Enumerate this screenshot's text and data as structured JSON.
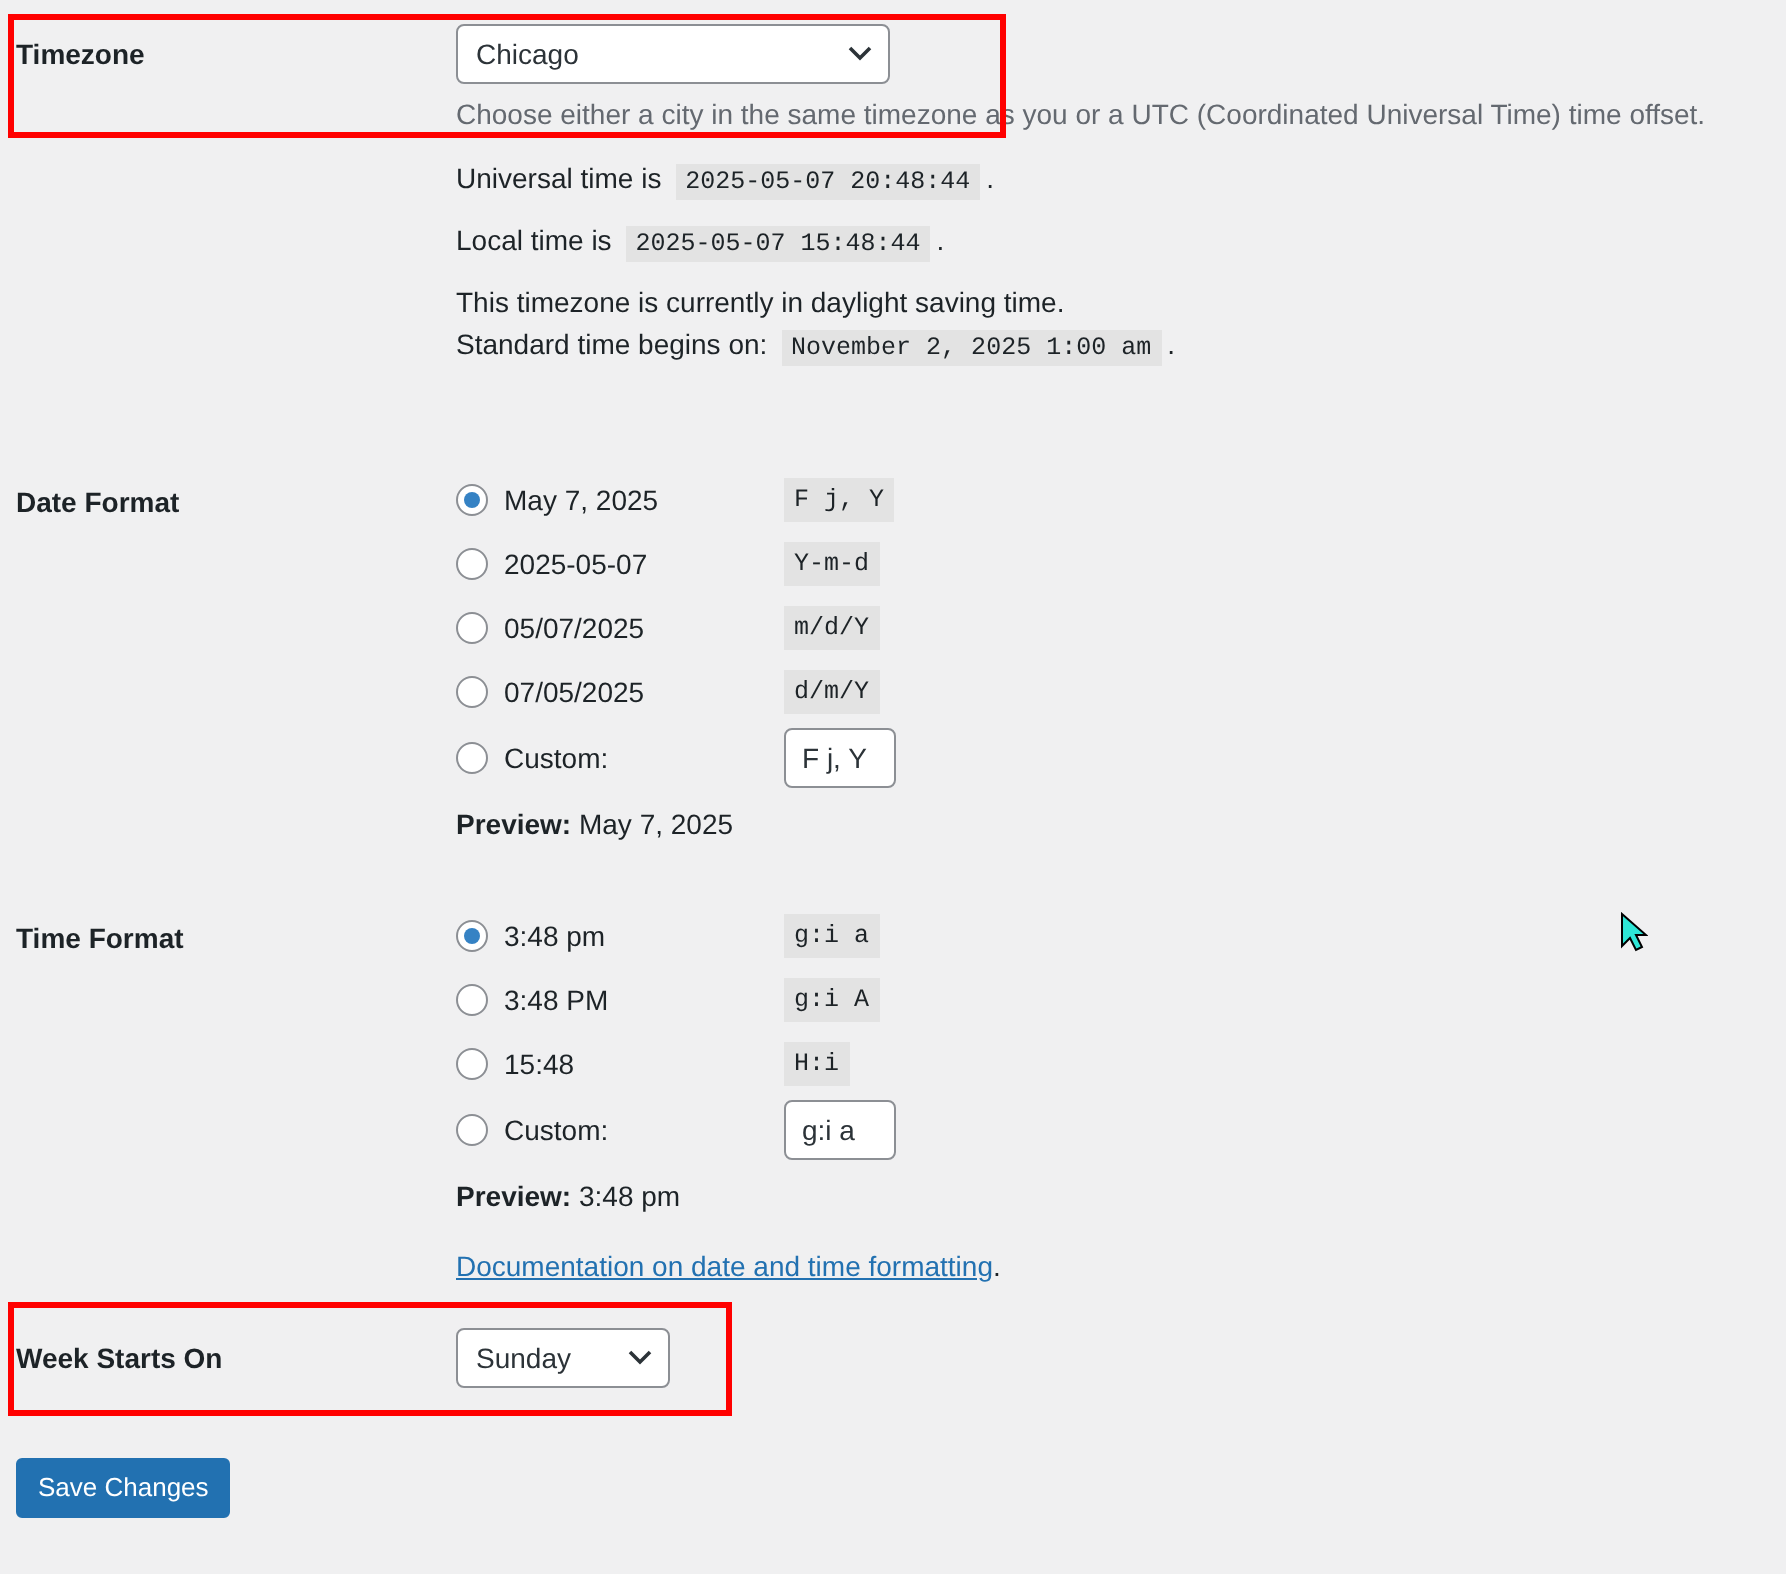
{
  "sections": [
    {
      "kind": "select",
      "label": "Timezone",
      "highlighted": true,
      "value": "Chicago",
      "description": "Choose either a city in the same timezone as you or a UTC (Coordinated Universal Time) time offset.",
      "info": [
        {
          "lines": [
            {
              "text": "Universal time is",
              "code": "2025-05-07 20:48:44",
              "end": "."
            }
          ]
        },
        {
          "lines": [
            {
              "text": "Local time is",
              "code": "2025-05-07 15:48:44",
              "end": "."
            }
          ]
        },
        {
          "lines": [
            {
              "text": "This timezone is currently in daylight saving time."
            },
            {
              "text": "Standard time begins on:",
              "code": "November 2, 2025 1:00 am",
              "end": "."
            }
          ]
        }
      ]
    },
    {
      "kind": "radios",
      "label": "Date Format",
      "highlighted": false,
      "options": [
        {
          "kind": "preset",
          "label": "May 7, 2025",
          "format": "F j, Y",
          "selected": true
        },
        {
          "kind": "preset",
          "label": "2025-05-07",
          "format": "Y-m-d",
          "selected": false
        },
        {
          "kind": "preset",
          "label": "05/07/2025",
          "format": "m/d/Y",
          "selected": false
        },
        {
          "kind": "preset",
          "label": "07/05/2025",
          "format": "d/m/Y",
          "selected": false
        },
        {
          "kind": "custom",
          "label": "Custom:",
          "value": "F j, Y",
          "selected": false
        }
      ],
      "preview": "**Preview:** May 7, 2025"
    },
    {
      "kind": "radios",
      "label": "Time Format",
      "highlighted": false,
      "options": [
        {
          "kind": "preset",
          "label": "3:48 pm",
          "format": "g:i a",
          "selected": true
        },
        {
          "kind": "preset",
          "label": "3:48 PM",
          "format": "g:i A",
          "selected": false
        },
        {
          "kind": "preset",
          "label": "15:48",
          "format": "H:i",
          "selected": false
        },
        {
          "kind": "custom",
          "label": "Custom:",
          "value": "g:i a",
          "selected": false
        }
      ],
      "preview": "**Preview:** 3:48 pm",
      "link": {
        "text": "Documentation on date and time formatting",
        "end": "."
      }
    },
    {
      "kind": "select",
      "label": "Week Starts On",
      "highlighted": true,
      "value": "Sunday"
    }
  ],
  "button": {
    "label": "Save Changes"
  }
}
